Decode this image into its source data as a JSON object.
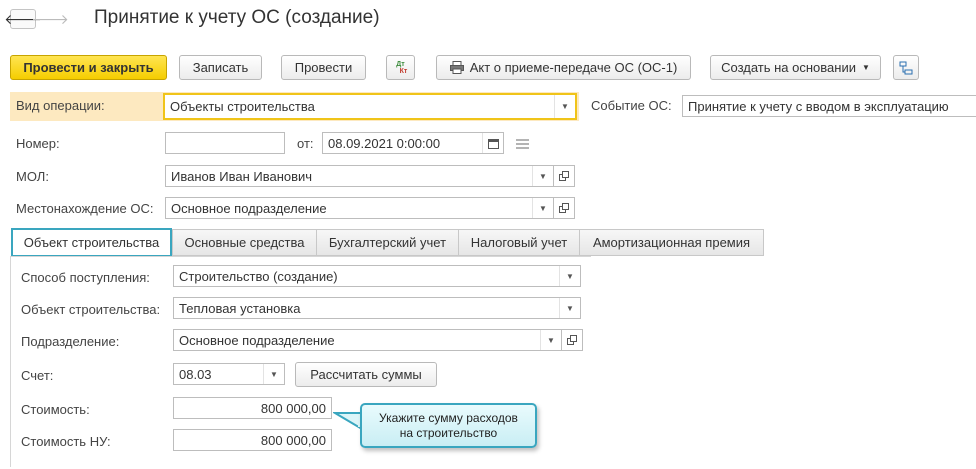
{
  "header": {
    "back_icon": "arrow-left-icon",
    "forward_icon": "arrow-right-icon",
    "title": "Принятие к учету ОС (создание)"
  },
  "toolbar": {
    "post_close": "Провести и закрыть",
    "save": "Записать",
    "post": "Провести",
    "dt_kt_top": "Дт",
    "dt_kt_bottom": "Кт",
    "act": "Акт о приеме-передаче ОС (ОС-1)",
    "create_based": "Создать на основании",
    "structure_icon": "structure-icon"
  },
  "form": {
    "op_type_label": "Вид операции:",
    "op_type_value": "Объекты строительства",
    "event_label": "Событие ОС:",
    "event_value": "Принятие к учету с вводом в эксплуатацию",
    "number_label": "Номер:",
    "number_value": "",
    "date_label": "от:",
    "date_value": "08.09.2021  0:00:00",
    "mol_label": "МОЛ:",
    "mol_value": "Иванов Иван Иванович",
    "location_label": "Местонахождение ОС:",
    "location_value": "Основное подразделение"
  },
  "tabs": [
    {
      "label": "Объект строительства",
      "active": true
    },
    {
      "label": "Основные средства"
    },
    {
      "label": "Бухгалтерский учет"
    },
    {
      "label": "Налоговый учет"
    },
    {
      "label": "Амортизационная премия"
    }
  ],
  "tab_content": {
    "receipt_label": "Способ поступления:",
    "receipt_value": "Строительство (создание)",
    "object_label": "Объект строительства:",
    "object_value": "Тепловая установка",
    "division_label": "Подразделение:",
    "division_value": "Основное подразделение",
    "account_label": "Счет:",
    "account_value": "08.03",
    "calc_button": "Рассчитать суммы",
    "cost_label": "Стоимость:",
    "cost_value": "800 000,00",
    "cost_nu_label": "Стоимость НУ:",
    "cost_nu_value": "800 000,00"
  },
  "callout": {
    "line1": "Укажите сумму расходов",
    "line2": "на строительство"
  },
  "colors": {
    "primary_button": "#f5cd00",
    "highlight_row": "#fde9c0",
    "active_tab_border": "#3aa6bf",
    "callout_border": "#3aa6bf"
  }
}
